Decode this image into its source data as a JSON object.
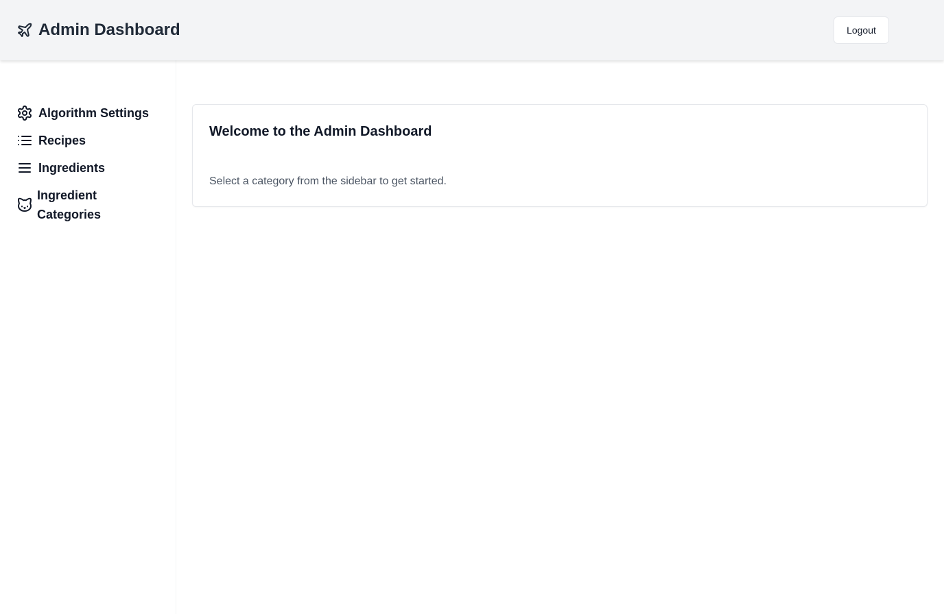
{
  "header": {
    "brand_icon": "plane-icon",
    "title": "Admin Dashboard",
    "logout_label": "Logout"
  },
  "sidebar": {
    "items": [
      {
        "icon": "gear-icon",
        "label": "Algorithm Settings"
      },
      {
        "icon": "list-icon",
        "label": "Recipes"
      },
      {
        "icon": "menu-icon",
        "label": "Ingredients"
      },
      {
        "icon": "cat-icon",
        "label": "Ingredient Categories"
      }
    ]
  },
  "main": {
    "card_title": "Welcome to the Admin Dashboard",
    "card_text": "Select a category from the sidebar to get started."
  },
  "colors": {
    "header_bg": "#f3f4f6",
    "text_primary": "#111827",
    "text_muted": "#4b5563",
    "border": "#e5e7eb"
  }
}
